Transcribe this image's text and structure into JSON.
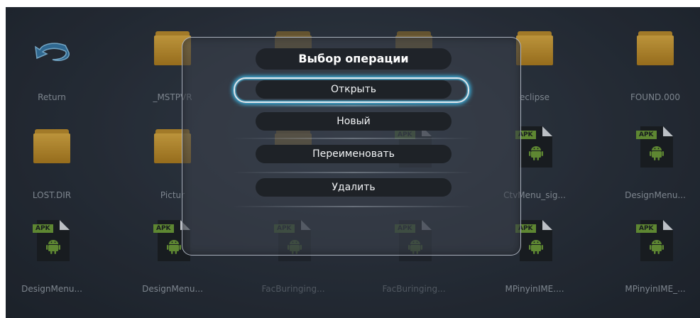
{
  "grid_items": [
    {
      "label": "Return",
      "icon": "return-icon",
      "type": "return"
    },
    {
      "label": "_MSTPVR",
      "icon": "folder-icon",
      "type": "folder"
    },
    {
      "label": "",
      "icon": "folder-icon",
      "type": "folder"
    },
    {
      "label": "",
      "icon": "folder-icon",
      "type": "folder"
    },
    {
      "label": "eclipse",
      "icon": "folder-icon",
      "type": "folder"
    },
    {
      "label": "FOUND.000",
      "icon": "folder-icon",
      "type": "folder"
    },
    {
      "label": "LOST.DIR",
      "icon": "folder-icon",
      "type": "folder"
    },
    {
      "label": "Pictur",
      "icon": "folder-icon",
      "type": "folder"
    },
    {
      "label": "",
      "icon": "folder-icon",
      "type": "folder"
    },
    {
      "label": "",
      "icon": "apk-file-icon",
      "type": "apk"
    },
    {
      "label": "CtvMenu_sig...",
      "icon": "apk-file-icon",
      "type": "apk"
    },
    {
      "label": "DesignMenu...",
      "icon": "apk-file-icon",
      "type": "apk"
    },
    {
      "label": "DesignMenu...",
      "icon": "apk-file-icon",
      "type": "apk"
    },
    {
      "label": "DesignMenu...",
      "icon": "apk-file-icon",
      "type": "apk"
    },
    {
      "label": "FacBuringing...",
      "icon": "apk-file-icon",
      "type": "apk"
    },
    {
      "label": "FacBuringing...",
      "icon": "apk-file-icon",
      "type": "apk"
    },
    {
      "label": "MPinyinIME....",
      "icon": "apk-file-icon",
      "type": "apk"
    },
    {
      "label": "MPinyinIME_...",
      "icon": "apk-file-icon",
      "type": "apk"
    }
  ],
  "apk_badge": "APK",
  "dialog": {
    "title": "Выбор операции",
    "options": [
      {
        "label": "Открыть",
        "focused": true
      },
      {
        "label": "Новый",
        "focused": false
      },
      {
        "label": "Переименовать",
        "focused": false
      },
      {
        "label": "Удалить",
        "focused": false
      }
    ]
  },
  "colors": {
    "accent_focus": "#3ab7e6",
    "folder": "#e8b545",
    "apk_badge": "#74a53a",
    "android": "#74a53a"
  }
}
